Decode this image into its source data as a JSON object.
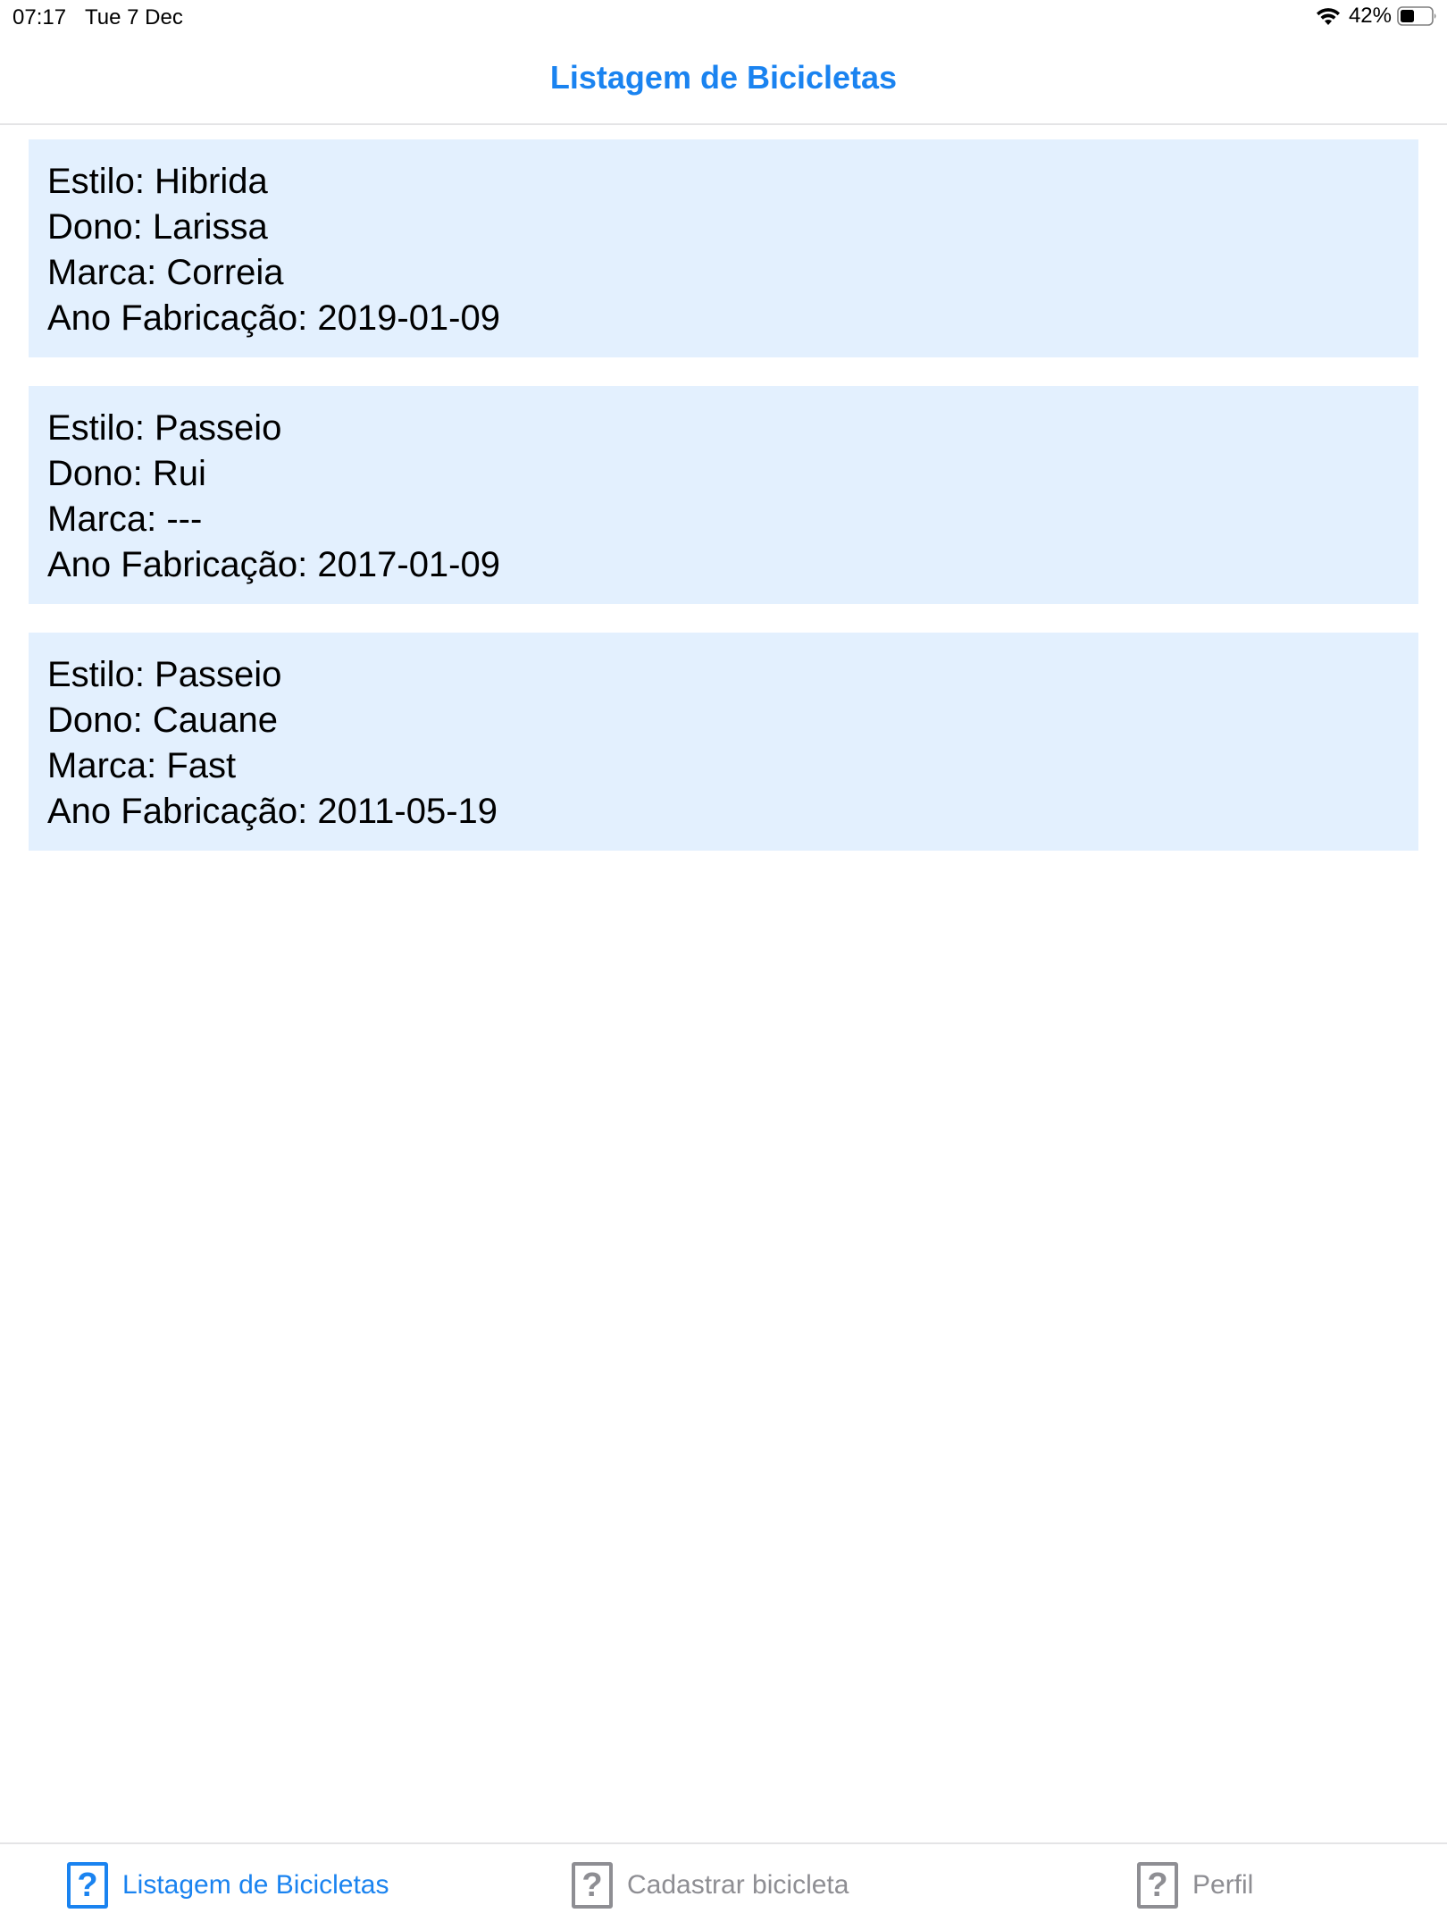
{
  "status_bar": {
    "time": "07:17",
    "date": "Tue 7 Dec",
    "battery": "42%",
    "wifi_icon": "wifi-icon",
    "battery_icon": "battery-icon"
  },
  "nav": {
    "title": "Listagem de Bicicletas"
  },
  "bikes": [
    {
      "estilo": "Estilo: Hibrida",
      "dono": "Dono: Larissa",
      "marca": "Marca: Correia",
      "ano": "Ano Fabricação: 2019-01-09"
    },
    {
      "estilo": "Estilo: Passeio",
      "dono": "Dono: Rui",
      "marca": "Marca: ---",
      "ano": "Ano Fabricação: 2017-01-09"
    },
    {
      "estilo": "Estilo: Passeio",
      "dono": "Dono: Cauane",
      "marca": "Marca: Fast",
      "ano": "Ano Fabricação: 2011-05-19"
    }
  ],
  "tabs": [
    {
      "label": "Listagem de Bicicletas",
      "icon": "question-mark-icon",
      "active": true
    },
    {
      "label": "Cadastrar bicicleta",
      "icon": "question-mark-icon",
      "active": false
    },
    {
      "label": "Perfil",
      "icon": "question-mark-icon",
      "active": false
    }
  ],
  "tab_icon_glyph": "?",
  "colors": {
    "accent": "#1a83f0",
    "card_background": "#e3f0fe",
    "inactive_tab": "#8e8e93"
  }
}
